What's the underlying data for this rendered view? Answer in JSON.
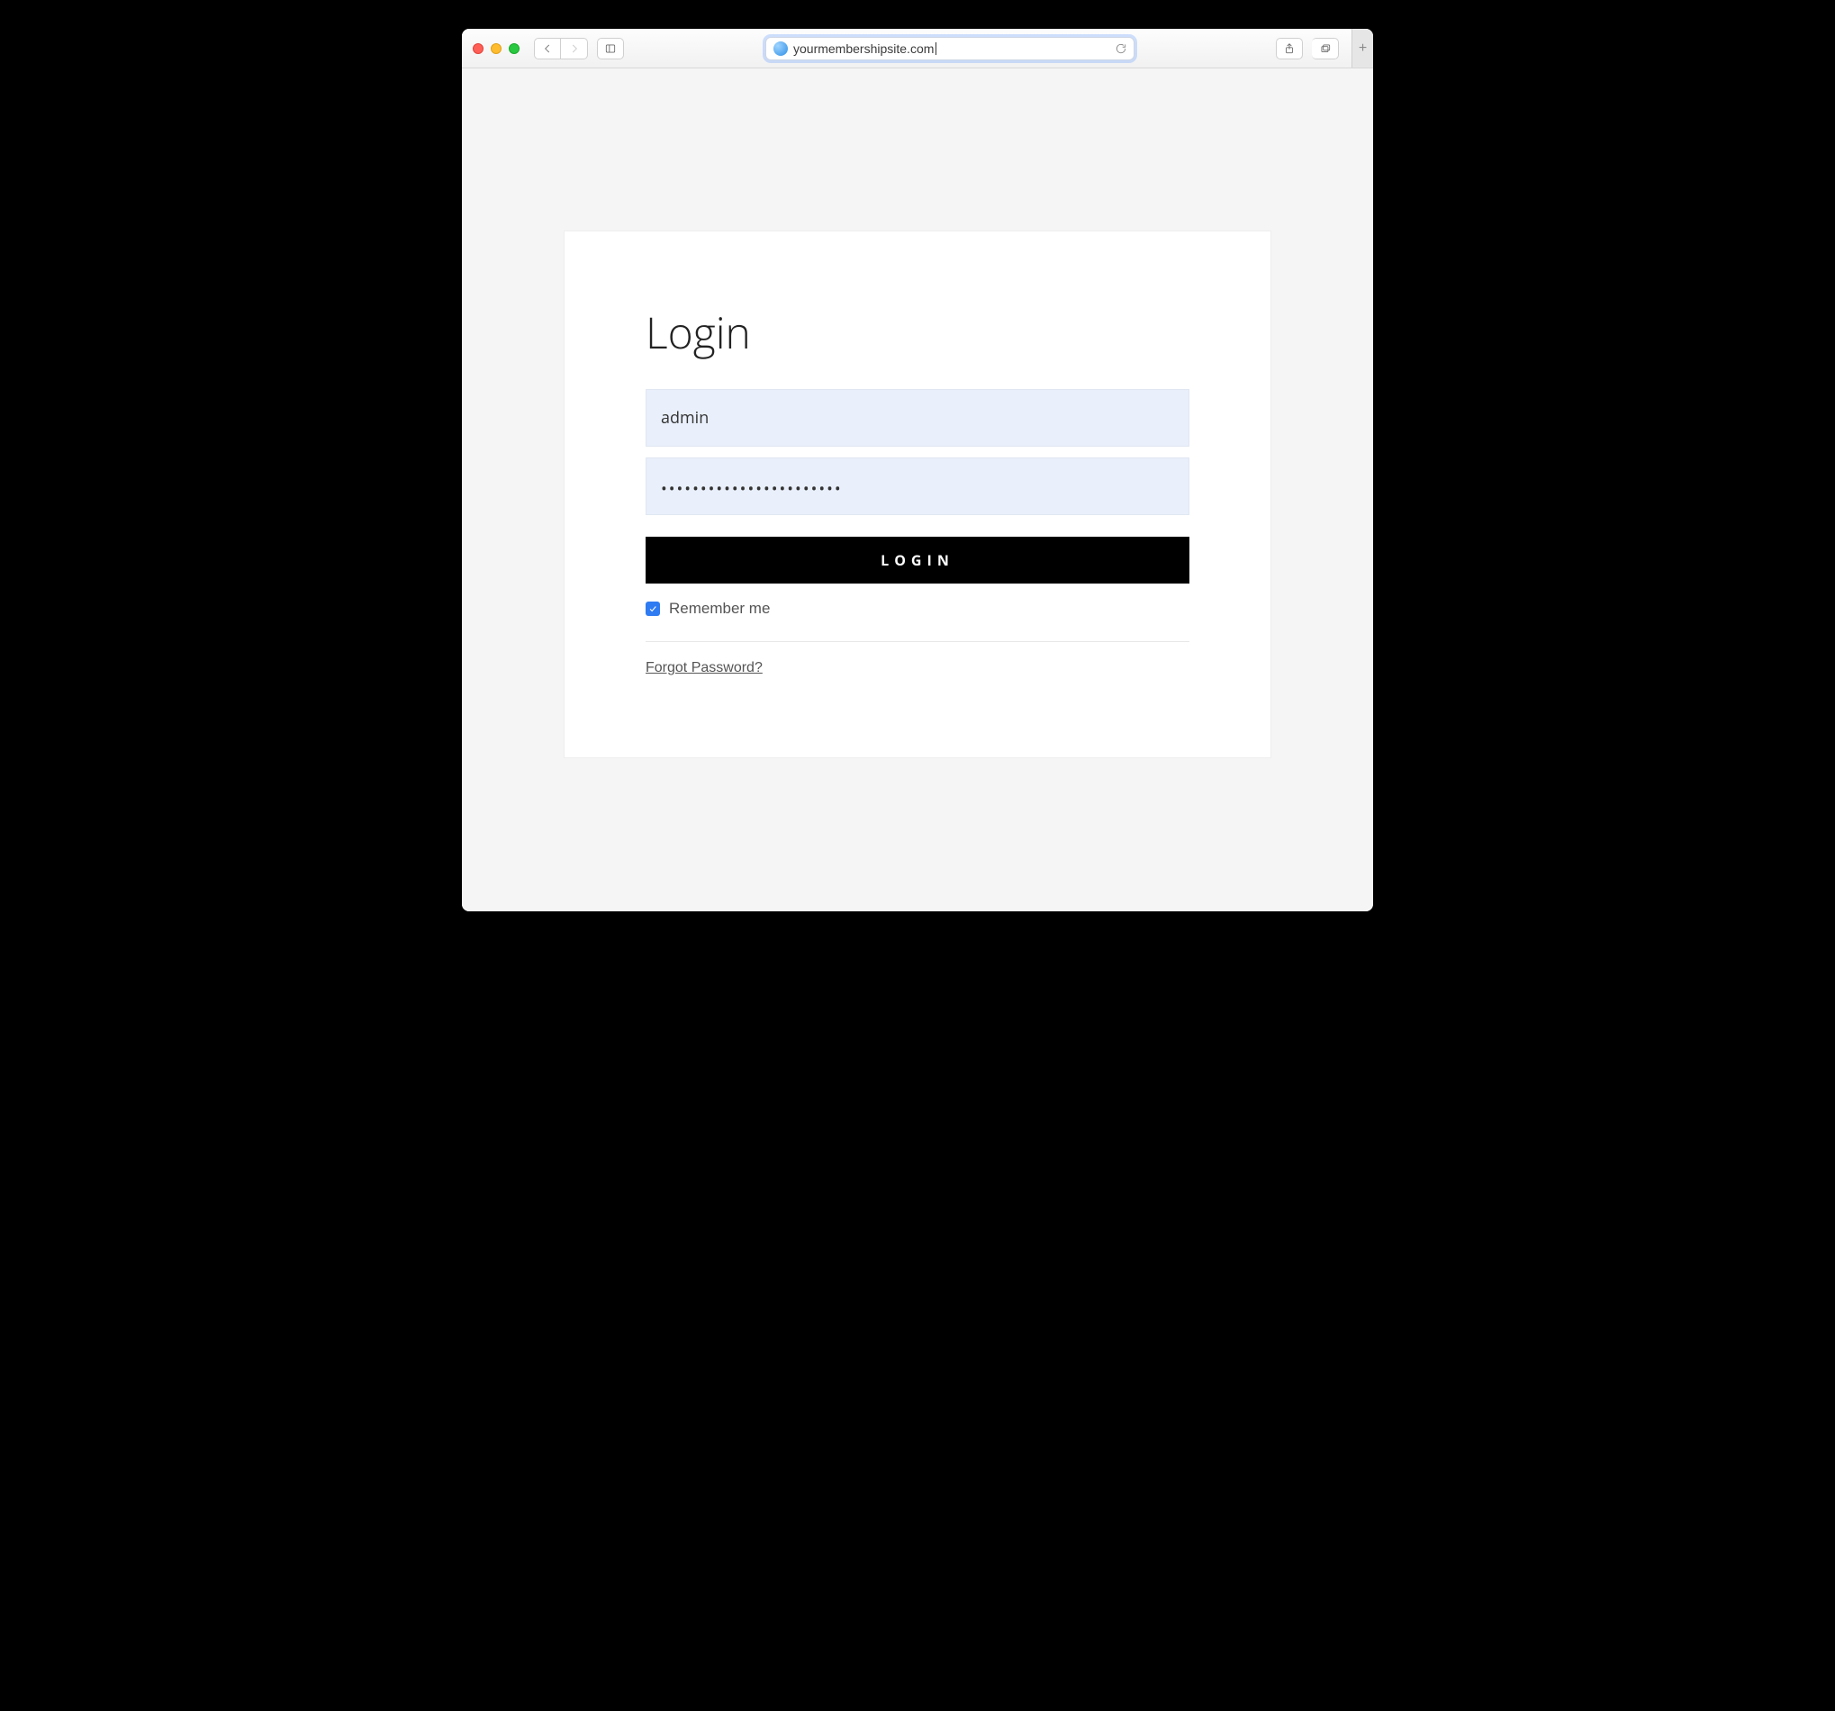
{
  "browser": {
    "url": "yourmembershipsite.com"
  },
  "login": {
    "title": "Login",
    "username_value": "admin",
    "password_value": "•••••••••••••••••••••••",
    "button_label": "LOGIN",
    "remember_label": "Remember me",
    "remember_checked": true,
    "forgot_label": "Forgot Password?"
  }
}
